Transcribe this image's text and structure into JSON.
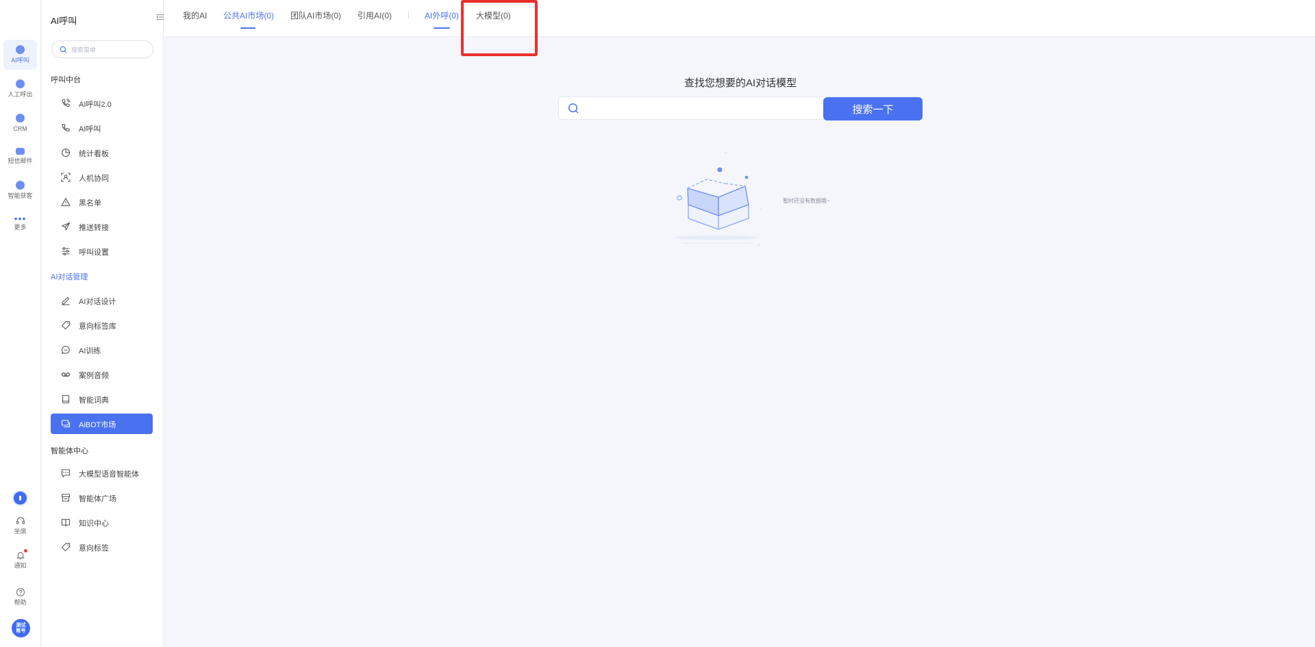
{
  "rail": {
    "items": [
      {
        "label": "AI呼叫",
        "icon": "ai-call-icon",
        "active": true
      },
      {
        "label": "人工呼出",
        "icon": "manual-call-icon"
      },
      {
        "label": "CRM",
        "icon": "crm-icon"
      },
      {
        "label": "短信邮件",
        "icon": "sms-mail-icon"
      },
      {
        "label": "智能获客",
        "icon": "smart-acquisition-icon"
      },
      {
        "label": "更多",
        "icon": "more-icon"
      }
    ],
    "bottom": [
      {
        "label": "坐席",
        "icon": "headset-icon"
      },
      {
        "label": "通知",
        "icon": "bell-icon"
      },
      {
        "label": "帮助",
        "icon": "help-icon"
      }
    ],
    "avatar_text_line1": "测试",
    "avatar_text_line2": "账号"
  },
  "menu": {
    "title": "AI呼叫",
    "search_placeholder": "搜索菜单",
    "groups": [
      {
        "label": "呼叫中台",
        "items": [
          {
            "label": "AI呼叫2.0",
            "icon": "phone-wave-icon"
          },
          {
            "label": "AI呼叫",
            "icon": "phone-icon"
          },
          {
            "label": "统计看板",
            "icon": "pie-chart-icon"
          },
          {
            "label": "人机协同",
            "icon": "scan-person-icon"
          },
          {
            "label": "黑名单",
            "icon": "warning-icon"
          },
          {
            "label": "推送转接",
            "icon": "send-icon"
          },
          {
            "label": "呼叫设置",
            "icon": "sliders-icon"
          }
        ]
      },
      {
        "label": "AI对话管理",
        "active": true,
        "items": [
          {
            "label": "AI对话设计",
            "icon": "edit-icon"
          },
          {
            "label": "意向标签库",
            "icon": "tag-icon"
          },
          {
            "label": "AI训练",
            "icon": "chat-circle-icon"
          },
          {
            "label": "案例音频",
            "icon": "voicemail-icon"
          },
          {
            "label": "智能词典",
            "icon": "book-icon"
          },
          {
            "label": "AiBOT市场",
            "icon": "bot-market-icon",
            "selected": true
          }
        ]
      },
      {
        "label": "智能体中心",
        "items": [
          {
            "label": "大模型语音智能体",
            "icon": "message-icon"
          },
          {
            "label": "智能体广场",
            "icon": "store-icon"
          },
          {
            "label": "知识中心",
            "icon": "open-book-icon"
          },
          {
            "label": "意向标签",
            "icon": "tag-icon"
          }
        ]
      }
    ]
  },
  "tabs": [
    {
      "label": "我的AI",
      "active": false
    },
    {
      "label": "公共AI市场(0)",
      "active": true
    },
    {
      "label": "团队AI市场(0)",
      "active": false
    },
    {
      "label": "引用AI(0)",
      "active": false
    },
    {
      "label": "AI外呼(0)",
      "active": true
    },
    {
      "label": "大模型(0)",
      "active": false,
      "highlighted": true
    }
  ],
  "content": {
    "title": "查找您想要的AI对话模型",
    "search_placeholder": "",
    "search_button": "搜索一下",
    "empty_text": "暂时还没有数据哦~"
  },
  "colors": {
    "accent": "#4a72f0",
    "highlight": "#ea2f2b",
    "background": "#f4f6fc"
  }
}
